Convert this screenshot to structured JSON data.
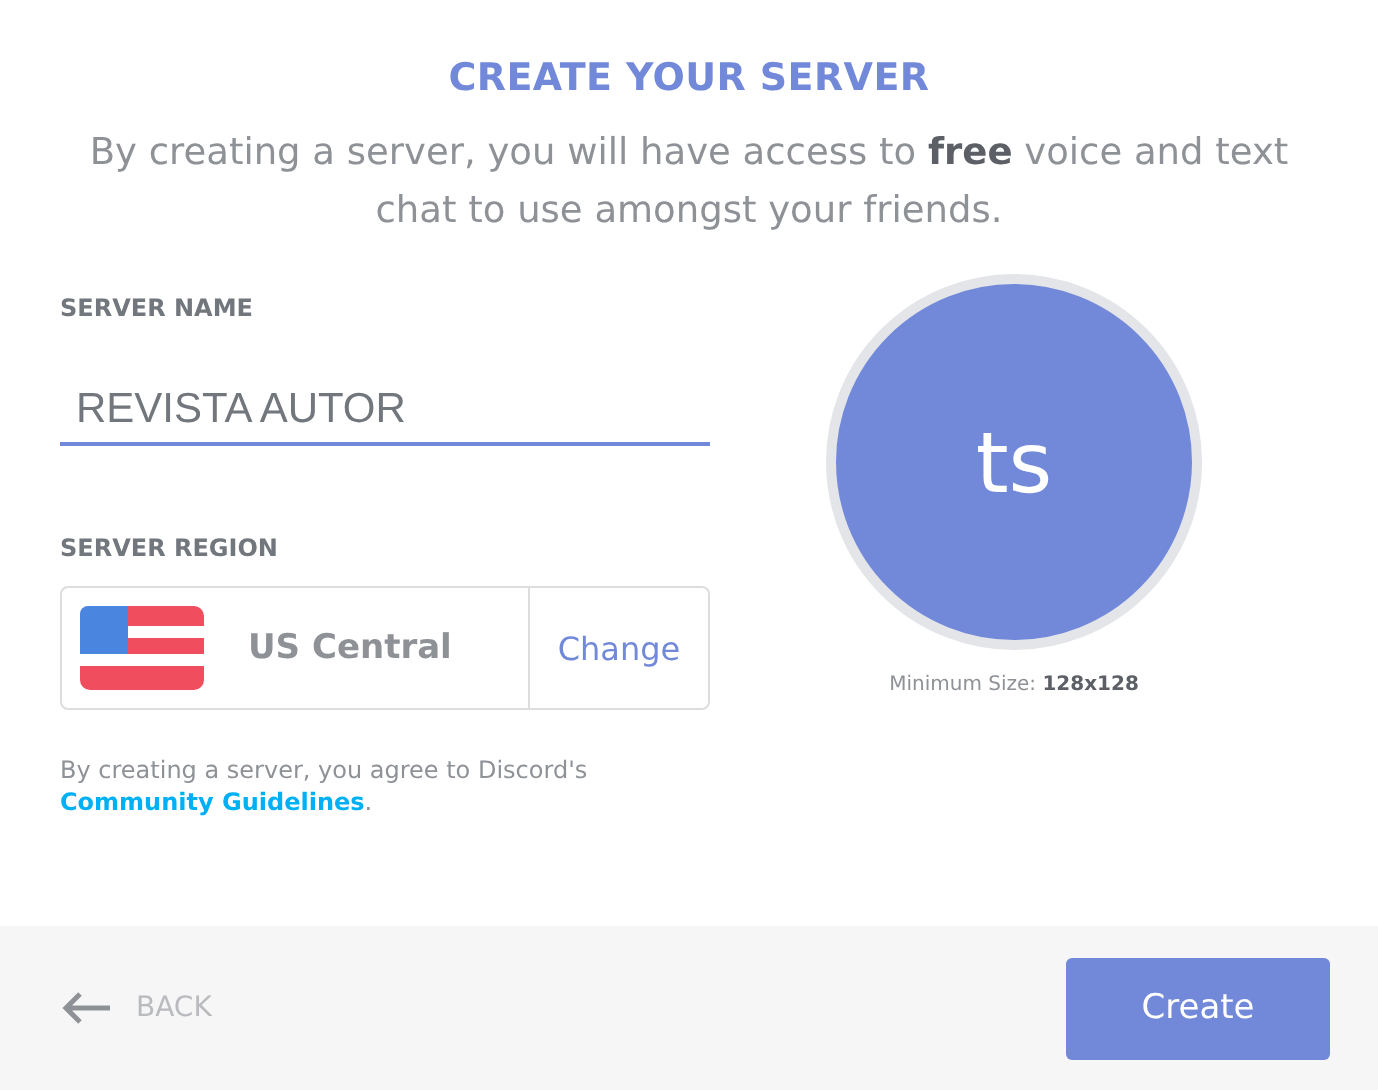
{
  "title": "CREATE YOUR SERVER",
  "subtitle": "By creating a server, you will have access to **free** voice and text chat to use amongst your friends.",
  "server_name": {
    "label": "SERVER NAME",
    "value": "REVISTA AUTOR"
  },
  "server_region": {
    "label": "SERVER REGION",
    "region": "US Central",
    "change": "Change"
  },
  "terms": {
    "text": "By creating a server, you agree to Discord's",
    "link": "Community Guidelines",
    "after": "."
  },
  "icon": {
    "initials": "ts",
    "hint": "Minimum Size: **128x128**"
  },
  "footer": {
    "back": "BACK",
    "create": "Create"
  }
}
